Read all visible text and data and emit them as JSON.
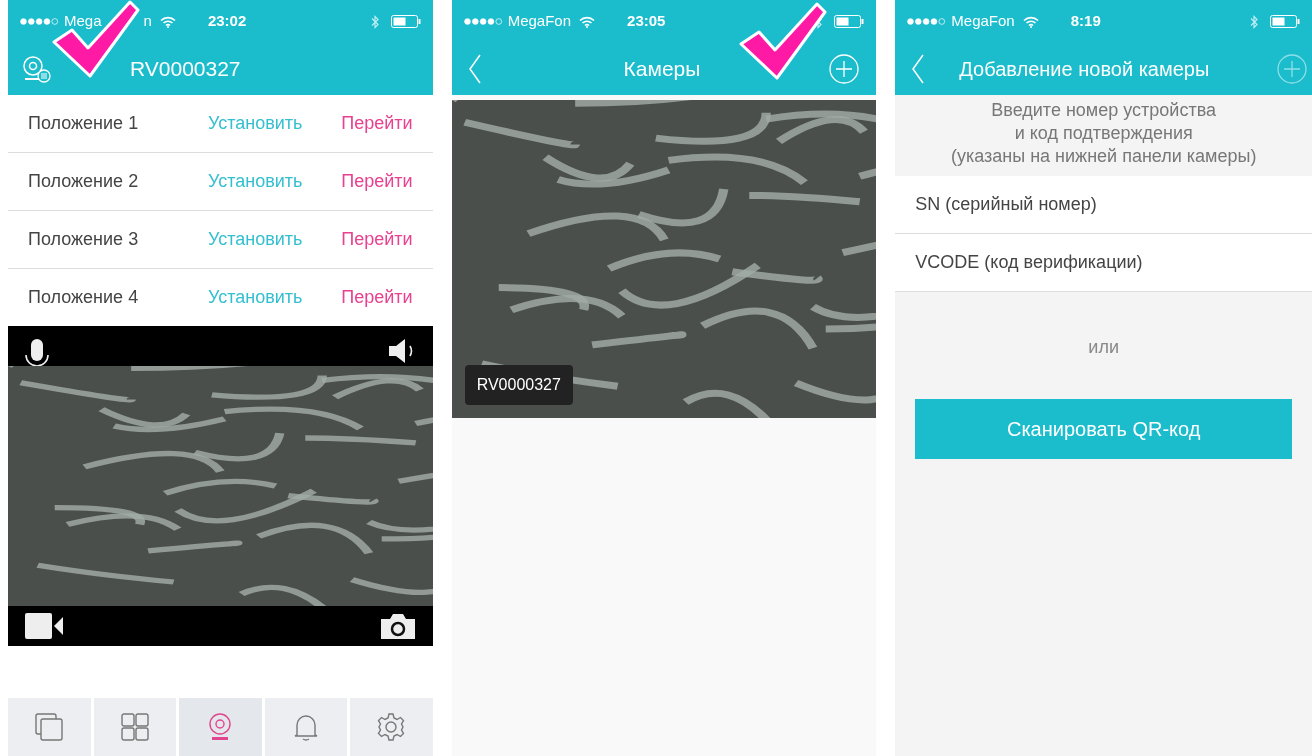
{
  "screens": [
    {
      "status_bar": {
        "carrier_parts": [
          "Mega",
          "n"
        ],
        "time": "23:02"
      },
      "nav": {
        "title": "RV0000327"
      },
      "presets": [
        {
          "label": "Положение 1",
          "set": "Установить",
          "go": "Перейти"
        },
        {
          "label": "Положение 2",
          "set": "Установить",
          "go": "Перейти"
        },
        {
          "label": "Положение 3",
          "set": "Установить",
          "go": "Перейти"
        },
        {
          "label": "Положение 4",
          "set": "Установить",
          "go": "Перейти"
        }
      ],
      "tab_bar": [
        {
          "selected": false
        },
        {
          "selected": false
        },
        {
          "selected": true
        },
        {
          "selected": false
        },
        {
          "selected": false
        }
      ]
    },
    {
      "status_bar": {
        "carrier_parts": [
          "MegaFon"
        ],
        "time": "23:05"
      },
      "nav": {
        "title": "Камеры"
      },
      "cameras": [
        {
          "name": "RV0000327"
        }
      ]
    },
    {
      "status_bar": {
        "carrier_parts": [
          "MegaFon"
        ],
        "time": "8:19"
      },
      "nav": {
        "title": "Добавление новой камеры"
      },
      "instructions": [
        "Введите номер устройства",
        "и код подтверждения",
        "(указаны на нижней панели камеры)"
      ],
      "fields": [
        {
          "placeholder": "SN (серийный номер)"
        },
        {
          "placeholder": "VCODE (код верификации)"
        }
      ],
      "or_text": "или",
      "scan_button": "Сканировать QR-код"
    }
  ]
}
